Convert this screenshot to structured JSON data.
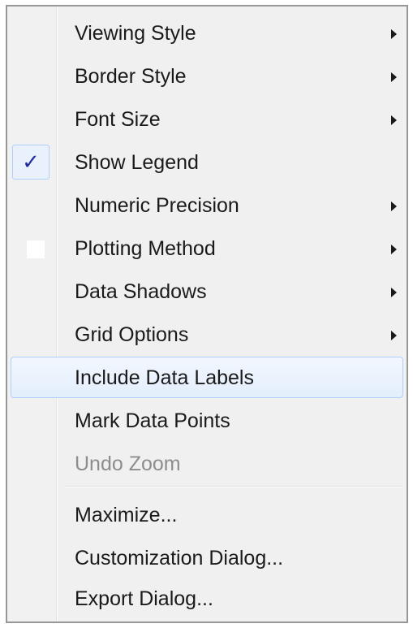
{
  "menu": {
    "items": [
      {
        "label": "Viewing Style",
        "submenu": true
      },
      {
        "label": "Border Style",
        "submenu": true
      },
      {
        "label": "Font Size",
        "submenu": true
      },
      {
        "label": "Show Legend",
        "submenu": false,
        "checked": true
      },
      {
        "label": "Numeric Precision",
        "submenu": true
      },
      {
        "label": "Plotting Method",
        "submenu": true
      },
      {
        "label": "Data Shadows",
        "submenu": true
      },
      {
        "label": "Grid Options",
        "submenu": true
      },
      {
        "label": "Include Data Labels",
        "submenu": false,
        "highlighted": true
      },
      {
        "label": "Mark Data Points",
        "submenu": false
      },
      {
        "label": "Undo Zoom",
        "submenu": false,
        "disabled": true
      },
      {
        "label": "Maximize...",
        "submenu": false
      },
      {
        "label": "Customization Dialog...",
        "submenu": false
      },
      {
        "label": "Export Dialog...",
        "submenu": false
      }
    ],
    "check_glyph": "✓",
    "colors": {
      "text": "#1a1a1a",
      "disabled_text": "#8d8d8d",
      "highlight_border": "#aecff7",
      "check": "#1f2fa0"
    }
  }
}
